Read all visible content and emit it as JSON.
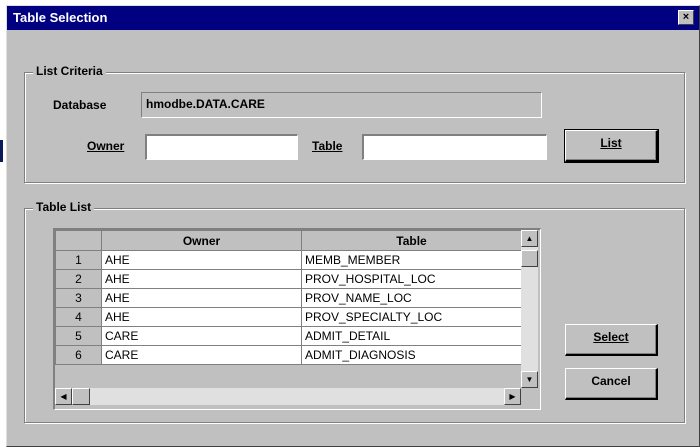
{
  "window": {
    "title": "Table Selection",
    "close_symbol": "×"
  },
  "list_criteria": {
    "legend": "List Criteria",
    "database_label": "Database",
    "database_value": "hmodbe.DATA.CARE",
    "owner_label": "Owner",
    "owner_value": "",
    "table_label": "Table",
    "table_value": "",
    "list_button": "List"
  },
  "table_list": {
    "legend": "Table List",
    "columns": [
      "Owner",
      "Table"
    ],
    "rows": [
      {
        "num": "1",
        "owner": "AHE",
        "table": "MEMB_MEMBER"
      },
      {
        "num": "2",
        "owner": "AHE",
        "table": "PROV_HOSPITAL_LOC"
      },
      {
        "num": "3",
        "owner": "AHE",
        "table": "PROV_NAME_LOC"
      },
      {
        "num": "4",
        "owner": "AHE",
        "table": "PROV_SPECIALTY_LOC"
      },
      {
        "num": "5",
        "owner": "CARE",
        "table": "ADMIT_DETAIL"
      },
      {
        "num": "6",
        "owner": "CARE",
        "table": "ADMIT_DIAGNOSIS"
      }
    ]
  },
  "buttons": {
    "select": "Select",
    "cancel": "Cancel"
  },
  "icons": {
    "scroll_up": "up-arrow-icon",
    "scroll_down": "down-arrow-icon",
    "scroll_left": "left-arrow-icon",
    "scroll_right": "right-arrow-icon"
  }
}
